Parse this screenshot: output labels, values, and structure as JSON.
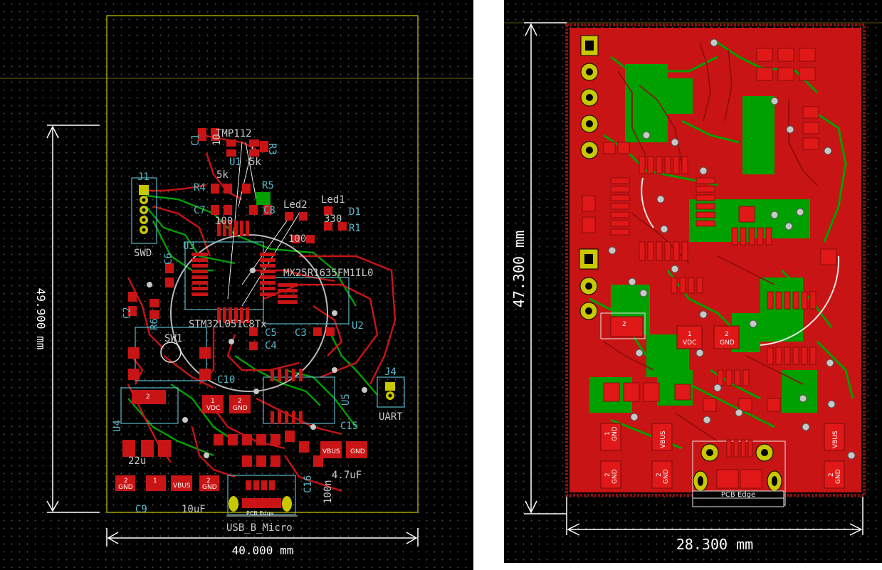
{
  "colors": {
    "background": "#000000",
    "grid": "#4a4a4a",
    "copper_front": "#c81414",
    "copper_back": "#00a000",
    "silkscreen": "#e8e8e8",
    "fabrication": "#59b8c8",
    "edge_cuts": "#c8c800",
    "pad_gold": "#c8c800",
    "ratsnest": "#ffffff"
  },
  "left_view": {
    "dimensions": {
      "width_label": "40.000 mm",
      "height_label": "49.900 mm"
    },
    "labels": {
      "tmp112": "TMP112",
      "c1": "C1",
      "c1_val": "10",
      "u1": "U1",
      "r3": "R3",
      "r3_val": "5k",
      "r4": "R4",
      "r4_val": "5k",
      "r5": "R5",
      "c7": "C7",
      "c8": "C8",
      "c7_val": "100",
      "led2": "Led2",
      "led1": "Led1",
      "d1": "D1",
      "r1": "R1",
      "r1_val": "330",
      "j1": "J1",
      "swd": "SWD",
      "u3": "U3",
      "c6": "C6",
      "mx25": "MX25R1635FM1IL0",
      "stm32": "STM32L051C8Tx",
      "c2": "C2",
      "r6": "R6",
      "c3": "C3",
      "c4": "C4",
      "c5": "C5",
      "u2": "U2",
      "sw1": "SW1",
      "c10": "C10",
      "u5": "U5",
      "j4": "J4",
      "uart": "UART",
      "u4": "U4",
      "c15": "C15",
      "c16": "C16",
      "c16_val": "100n",
      "c15_val": "4.7uF",
      "c9": "C9",
      "c9_val": "22u",
      "c11_val": "10uF",
      "usb": "USB_B_Micro",
      "pcb_edge": "PCB Edge"
    },
    "pads": {
      "vdc": "VDC",
      "gnd": "GND",
      "vbus": "VBUS",
      "p1": "1",
      "p2": "2"
    }
  },
  "right_view": {
    "dimensions": {
      "width_label": "28.300 mm",
      "height_label": "47.300 mm"
    },
    "pads": {
      "vdc": "VDC",
      "gnd": "GND",
      "vbus": "VBUS",
      "p1": "1",
      "p2": "2",
      "pcb_edge": "PCB Edge"
    }
  }
}
